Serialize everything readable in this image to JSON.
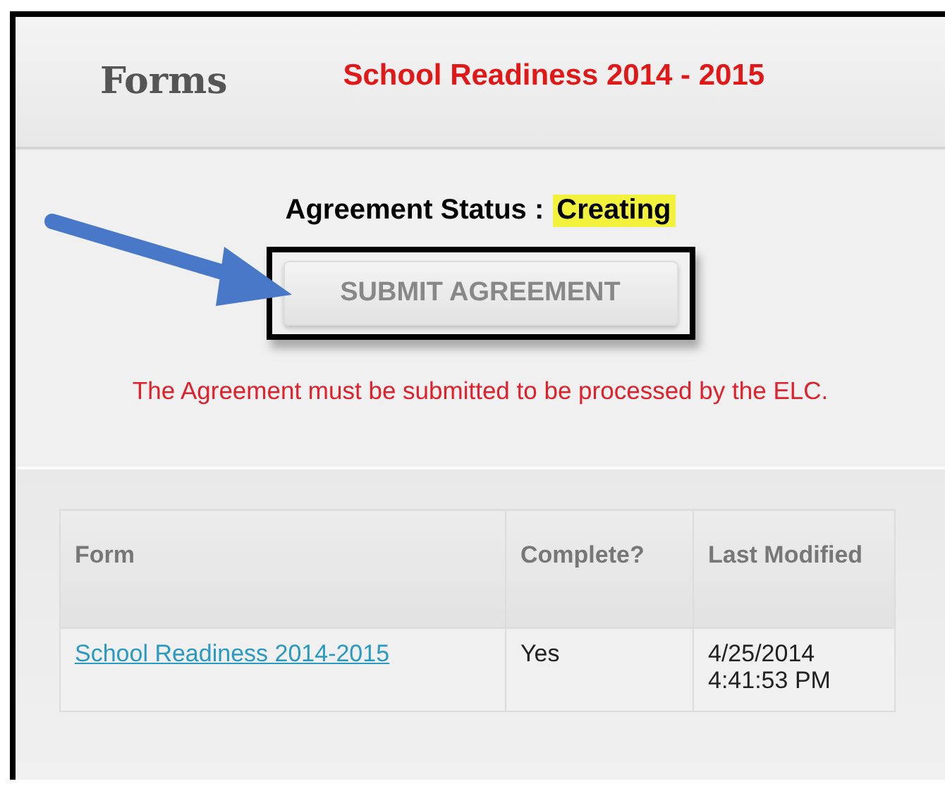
{
  "header": {
    "title": "Forms",
    "program": "School Readiness 2014 - 2015"
  },
  "status": {
    "label": "Agreement Status :",
    "value": "Creating",
    "highlighted": true
  },
  "submit_button": {
    "label": "SUBMIT AGREEMENT",
    "disabled": true,
    "outlined": true
  },
  "message": "The Agreement must be submitted to be processed by the ELC.",
  "table": {
    "columns": [
      "Form",
      "Complete?",
      "Last Modified"
    ],
    "rows": [
      {
        "form": "School Readiness 2014-2015",
        "complete": "Yes",
        "modified": [
          "4/25/2014",
          "4:41:53 PM"
        ]
      }
    ]
  }
}
